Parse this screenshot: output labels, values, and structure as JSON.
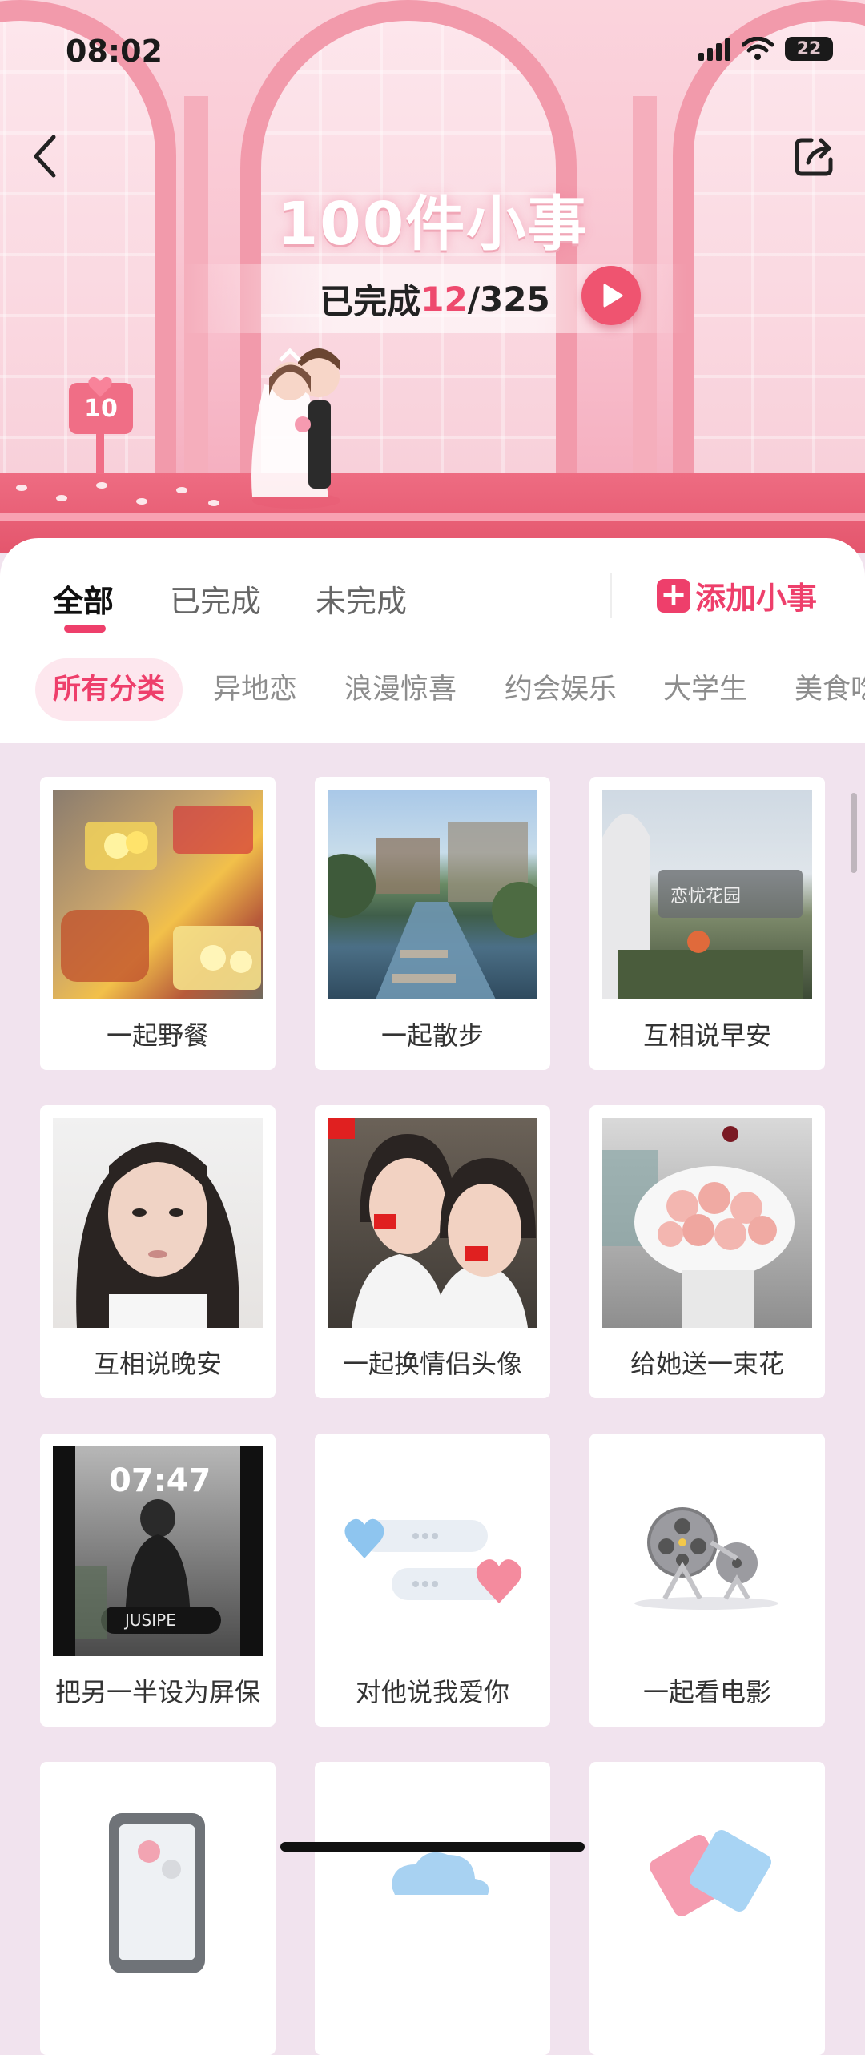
{
  "status_bar": {
    "time": "08:02",
    "battery": "22"
  },
  "header": {
    "title": "100件小事",
    "progress_prefix": "已完成",
    "completed": "12",
    "progress_suffix": "/325",
    "sign_number": "10"
  },
  "tabs": [
    {
      "label": "全部",
      "active": true
    },
    {
      "label": "已完成",
      "active": false
    },
    {
      "label": "未完成",
      "active": false
    }
  ],
  "add_button": {
    "icon": "+",
    "label": "添加小事"
  },
  "categories": [
    "所有分类",
    "异地恋",
    "浪漫惊喜",
    "约会娱乐",
    "大学生",
    "美食吃"
  ],
  "items": [
    {
      "label": "一起野餐",
      "image": "picnic-photo"
    },
    {
      "label": "一起散步",
      "image": "garden-canal-photo"
    },
    {
      "label": "互相说早安",
      "image": "garden-entrance-photo"
    },
    {
      "label": "互相说晚安",
      "image": "selfie-photo"
    },
    {
      "label": "一起换情侣头像",
      "image": "couple-selfie-photo"
    },
    {
      "label": "给她送一束花",
      "image": "rose-bouquet-photo"
    },
    {
      "label": "把另一半设为屏保",
      "image": "lockscreen-photo"
    },
    {
      "label": "对他说我爱你",
      "image": "chat-hearts-icon"
    },
    {
      "label": "一起看电影",
      "image": "film-projector-icon"
    },
    {
      "label": "",
      "image": "phone-icon"
    },
    {
      "label": "",
      "image": "cloud-icon"
    },
    {
      "label": "",
      "image": "cards-icon"
    }
  ]
}
